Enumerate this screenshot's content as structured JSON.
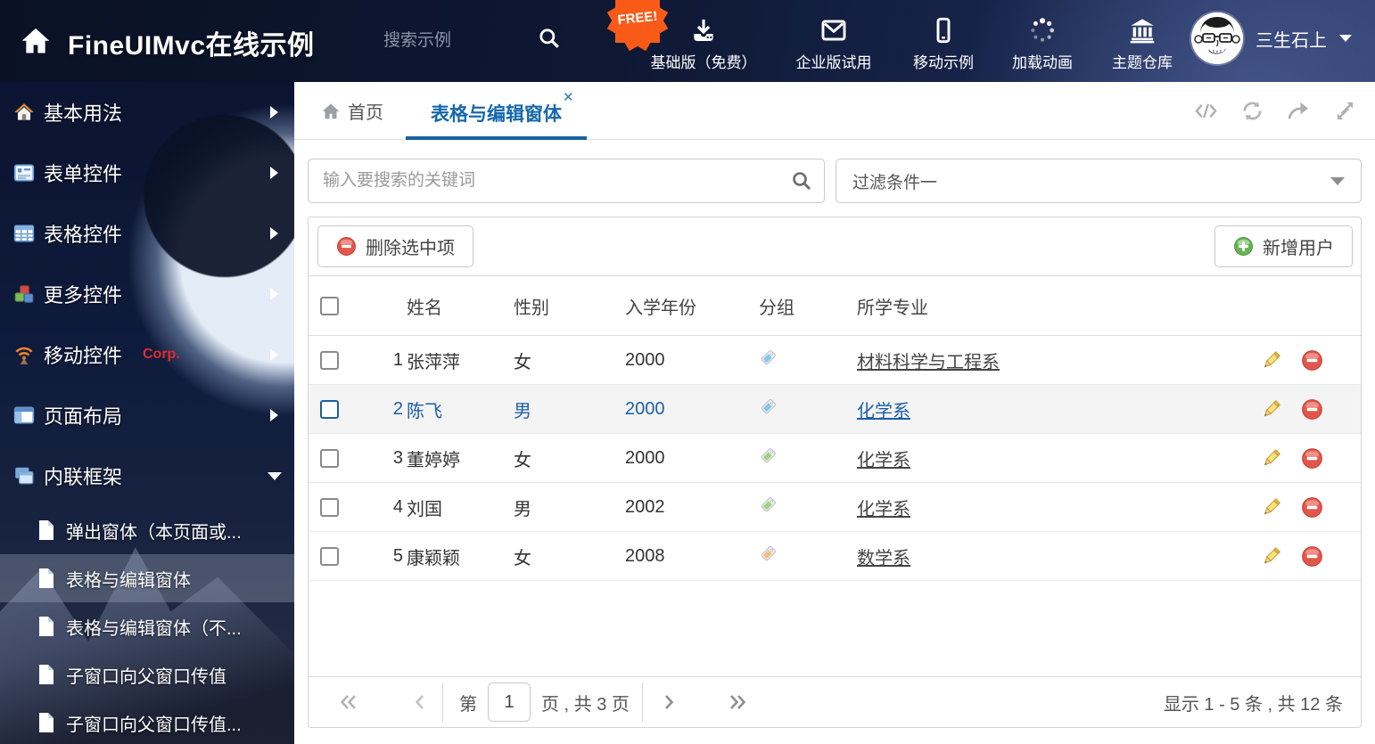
{
  "header": {
    "title": "FineUIMvc在线示例",
    "search_placeholder": "搜索示例",
    "free_badge": "FREE!",
    "nav_items": [
      {
        "label": "基础版（免费）",
        "icon": "download-icon"
      },
      {
        "label": "企业版试用",
        "icon": "envelope-icon"
      },
      {
        "label": "移动示例",
        "icon": "mobile-icon"
      },
      {
        "label": "加载动画",
        "icon": "spinner-icon"
      },
      {
        "label": "主题仓库",
        "icon": "bank-icon"
      }
    ],
    "user_name": "三生石上"
  },
  "sidebar": {
    "items": [
      {
        "label": "基本用法",
        "icon": "home-icon"
      },
      {
        "label": "表单控件",
        "icon": "form-icon"
      },
      {
        "label": "表格控件",
        "icon": "table-icon"
      },
      {
        "label": "更多控件",
        "icon": "cubes-icon"
      },
      {
        "label": "移动控件",
        "badge": "Corp.",
        "icon": "wireless-icon"
      },
      {
        "label": "页面布局",
        "icon": "layout-icon"
      },
      {
        "label": "内联框架",
        "icon": "frames-icon",
        "expanded": true
      }
    ],
    "subitems": [
      {
        "label": "弹出窗体（本页面或..."
      },
      {
        "label": "表格与编辑窗体",
        "selected": true
      },
      {
        "label": "表格与编辑窗体（不..."
      },
      {
        "label": "子窗口向父窗口传值"
      },
      {
        "label": "子窗口向父窗口传值..."
      }
    ]
  },
  "tabs": {
    "home_label": "首页",
    "active_label": "表格与编辑窗体",
    "close_glyph": "✕"
  },
  "filter_bar": {
    "search_placeholder": "输入要搜索的关键词",
    "filter_value": "过滤条件一"
  },
  "toolbar": {
    "delete_label": "删除选中项",
    "add_label": "新增用户"
  },
  "table": {
    "columns": {
      "name": "姓名",
      "gender": "性别",
      "year": "入学年份",
      "group": "分组",
      "major": "所学专业"
    },
    "rows": [
      {
        "index": "1",
        "name": "张萍萍",
        "gender": "女",
        "year": "2000",
        "tag": "blue",
        "major": "材料科学与工程系",
        "selected": false
      },
      {
        "index": "2",
        "name": "陈飞",
        "gender": "男",
        "year": "2000",
        "tag": "blue",
        "major": "化学系",
        "selected": true
      },
      {
        "index": "3",
        "name": "董婷婷",
        "gender": "女",
        "year": "2000",
        "tag": "green",
        "major": "化学系",
        "selected": false
      },
      {
        "index": "4",
        "name": "刘国",
        "gender": "男",
        "year": "2002",
        "tag": "green",
        "major": "化学系",
        "selected": false
      },
      {
        "index": "5",
        "name": "康颖颖",
        "gender": "女",
        "year": "2008",
        "tag": "orange",
        "major": "数学系",
        "selected": false
      }
    ]
  },
  "pagination": {
    "page_prefix": "第",
    "current_page": "1",
    "page_suffix": "页 , 共 3 页",
    "summary": "显示 1 - 5 条 , 共 12 条"
  },
  "colors": {
    "accent_blue": "#1568ac",
    "header_bg": "#0e1833",
    "tag_blue": "#86c5f0",
    "tag_green": "#a5cf87",
    "tag_orange": "#f6bd83",
    "delete_red": "#e2574c",
    "add_green": "#67b355",
    "free_badge_orange": "#f95a18",
    "corp_red": "#e02b2b",
    "selected_row_bg": "#f4f4f4"
  }
}
